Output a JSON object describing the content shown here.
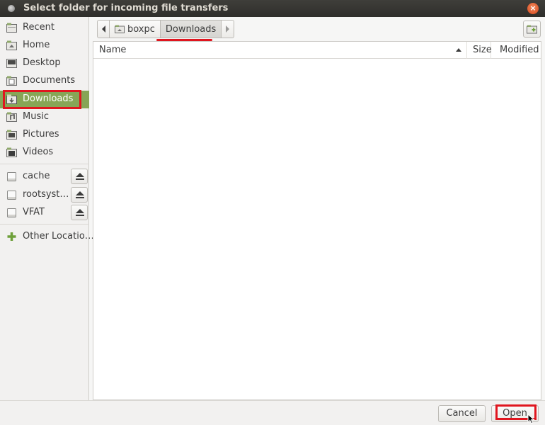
{
  "window": {
    "title": "Select folder for incoming file transfers"
  },
  "sidebar": {
    "places": [
      {
        "label": "Recent",
        "icon": "recent-icon"
      },
      {
        "label": "Home",
        "icon": "home-icon"
      },
      {
        "label": "Desktop",
        "icon": "desktop-icon"
      },
      {
        "label": "Documents",
        "icon": "documents-icon"
      },
      {
        "label": "Downloads",
        "icon": "downloads-icon",
        "selected": true
      },
      {
        "label": "Music",
        "icon": "music-icon"
      },
      {
        "label": "Pictures",
        "icon": "pictures-icon"
      },
      {
        "label": "Videos",
        "icon": "videos-icon"
      }
    ],
    "devices": [
      {
        "label": "cache",
        "icon": "drive-icon"
      },
      {
        "label": "rootsyst…",
        "icon": "drive-icon"
      },
      {
        "label": "VFAT",
        "icon": "drive-icon"
      }
    ],
    "other": {
      "label": "Other Locatio…",
      "icon": "plus-icon"
    }
  },
  "pathbar": {
    "segments": [
      "boxpc",
      "Downloads"
    ],
    "current": "Downloads"
  },
  "filelist": {
    "columns": {
      "name": "Name",
      "size": "Size",
      "modified": "Modified"
    },
    "sort": "name-ascending",
    "rows": []
  },
  "buttons": {
    "cancel": "Cancel",
    "open": "Open"
  },
  "colors": {
    "selected": "#87a556",
    "highlight": "#e0161f",
    "titlebar": "#3a3935"
  }
}
